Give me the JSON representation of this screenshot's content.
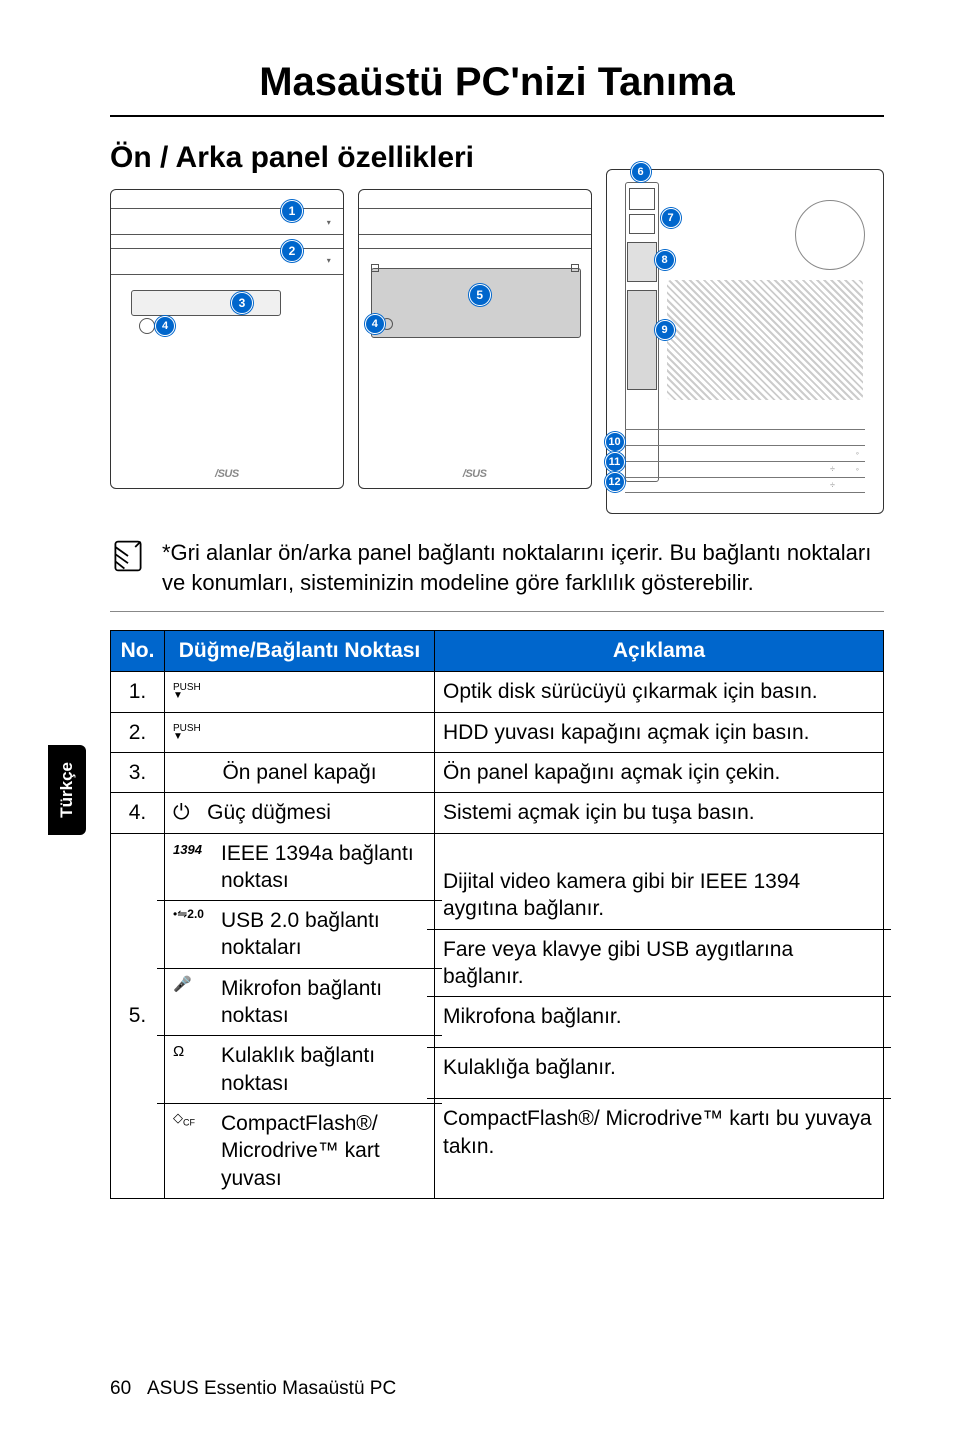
{
  "sideTab": "Türkçe",
  "title": "Masaüstü PC'nizi Tanıma",
  "subtitle": "Ön / Arka panel özellikleri",
  "callouts": [
    "1",
    "2",
    "3",
    "4",
    "5",
    "6",
    "7",
    "8",
    "9",
    "10",
    "11",
    "12"
  ],
  "note": "*Gri alanlar ön/arka panel bağlantı noktalarını içerir. Bu bağlantı noktaları ve konumları, sisteminizin modeline göre farklılık gösterebilir.",
  "table": {
    "headers": {
      "no": "No.",
      "btn": "Düğme/Bağlantı Noktası",
      "desc": "Açıklama"
    },
    "rows": [
      {
        "no": "1.",
        "btnIcon": "push",
        "btn": "",
        "desc": "Optik disk sürücüyü çıkarmak için basın."
      },
      {
        "no": "2.",
        "btnIcon": "push",
        "btn": "",
        "desc": "HDD yuvası kapağını açmak için basın."
      },
      {
        "no": "3.",
        "btnIcon": "",
        "btn": "Ön panel kapağı",
        "desc": "Ön panel kapağını açmak için çekin."
      },
      {
        "no": "4.",
        "btnIcon": "power",
        "btn": "Güç düğmesi",
        "desc": "Sistemi açmak için bu tuşa basın."
      }
    ],
    "row5": {
      "no": "5.",
      "items": [
        {
          "icon": "1394",
          "btn": "IEEE 1394a bağlantı noktası",
          "desc": "Dijital video kamera gibi bir IEEE 1394 aygıtına bağlanır."
        },
        {
          "icon": "usb",
          "btn": "USB 2.0 bağlantı noktaları",
          "desc": "Fare veya klavye gibi USB aygıtlarına bağlanır."
        },
        {
          "icon": "mic",
          "btn": "Mikrofon bağlantı noktası",
          "desc": "Mikrofona bağlanır."
        },
        {
          "icon": "hp",
          "btn": "Kulaklık bağlantı noktası",
          "desc": "Kulaklığa bağlanır."
        },
        {
          "icon": "cf",
          "btn": "CompactFlash®/ Microdrive™ kart yuvası",
          "desc": "CompactFlash®/ Microdrive™ kartı bu yuvaya takın."
        }
      ]
    }
  },
  "footer": {
    "page": "60",
    "text": "ASUS Essentio Masaüstü PC"
  },
  "asusLogo": "/SUS"
}
